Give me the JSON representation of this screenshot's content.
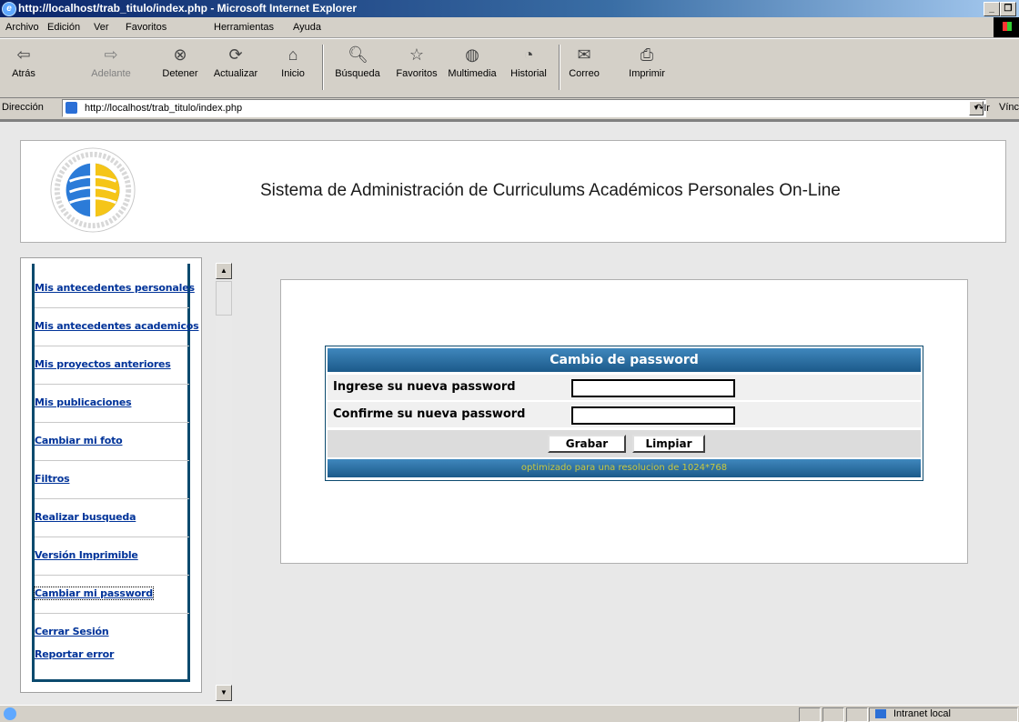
{
  "window": {
    "title": "http://localhost/trab_titulo/index.php - Microsoft Internet Explorer"
  },
  "menu": [
    "Archivo",
    "Edición",
    "Ver",
    "Favoritos",
    "Herramientas",
    "Ayuda"
  ],
  "toolbar": {
    "back": "Atrás",
    "forward": "Adelante",
    "stop": "Detener",
    "refresh": "Actualizar",
    "home": "Inicio",
    "search": "Búsqueda",
    "favorites": "Favoritos",
    "media": "Multimedia",
    "history": "Historial",
    "mail": "Correo",
    "print": "Imprimir"
  },
  "address": {
    "label": "Dirección",
    "url": "http://localhost/trab_titulo/index.php",
    "go": "Ir",
    "links": "Víncul"
  },
  "header": {
    "title": "Sistema de Administración de Curriculums Académicos Personales On-Line"
  },
  "sidebar": {
    "items": [
      "Mis antecedentes personales",
      "Mis antecedentes academicos",
      "Mis proyectos anteriores",
      "Mis publicaciones",
      "Cambiar mi foto",
      "Filtros",
      "Realizar busqueda",
      "Versión Imprimible",
      "Cambiar mi password",
      "Cerrar Sesión",
      "Reportar error"
    ]
  },
  "form": {
    "title": "Cambio de password",
    "new_password_label": "Ingrese su nueva password",
    "new_password_value": "",
    "confirm_label": "Confirme su nueva password",
    "confirm_value": "",
    "save": "Grabar",
    "clear": "Limpiar",
    "footer": "optimizado para una resolucion de 1024*768"
  },
  "status": {
    "zone": "Intranet local"
  }
}
